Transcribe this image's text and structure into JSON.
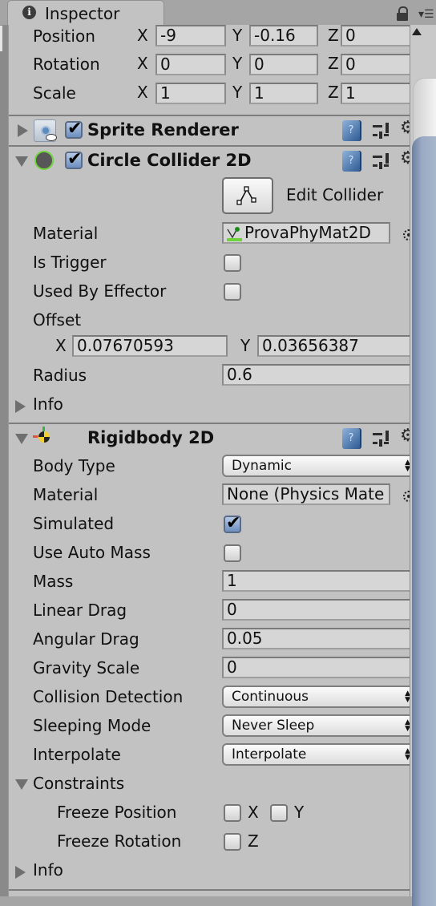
{
  "tab": {
    "title": "Inspector",
    "icon": "info-icon"
  },
  "transform": {
    "rows": [
      {
        "label": "Position",
        "x": "-9",
        "y": "-0.16",
        "z": "0"
      },
      {
        "label": "Rotation",
        "x": "0",
        "y": "0",
        "z": "0"
      },
      {
        "label": "Scale",
        "x": "1",
        "y": "1",
        "z": "1"
      }
    ],
    "axes": {
      "x": "X",
      "y": "Y",
      "z": "Z"
    }
  },
  "sprite_renderer": {
    "title": "Sprite Renderer",
    "enabled": true,
    "expanded": false
  },
  "circle_collider": {
    "title": "Circle Collider 2D",
    "enabled": true,
    "expanded": true,
    "edit_collider_label": "Edit Collider",
    "material_label": "Material",
    "material_value": "ProvaPhyMat2D",
    "is_trigger_label": "Is Trigger",
    "is_trigger": false,
    "used_by_effector_label": "Used By Effector",
    "used_by_effector": false,
    "offset_label": "Offset",
    "offset_x": "0.07670593",
    "offset_y": "0.03656387",
    "radius_label": "Radius",
    "radius": "0.6",
    "info_label": "Info"
  },
  "rigidbody": {
    "title": "Rigidbody 2D",
    "expanded": true,
    "body_type_label": "Body Type",
    "body_type": "Dynamic",
    "material_label": "Material",
    "material_value": "None (Physics Mate",
    "simulated_label": "Simulated",
    "simulated": true,
    "use_auto_mass_label": "Use Auto Mass",
    "use_auto_mass": false,
    "mass_label": "Mass",
    "mass": "1",
    "linear_drag_label": "Linear Drag",
    "linear_drag": "0",
    "angular_drag_label": "Angular Drag",
    "angular_drag": "0.05",
    "gravity_scale_label": "Gravity Scale",
    "gravity_scale": "0",
    "collision_detection_label": "Collision Detection",
    "collision_detection": "Continuous",
    "sleeping_mode_label": "Sleeping Mode",
    "sleeping_mode": "Never Sleep",
    "interpolate_label": "Interpolate",
    "interpolate": "Interpolate",
    "constraints_label": "Constraints",
    "freeze_position_label": "Freeze Position",
    "freeze_position_x": false,
    "freeze_position_y": false,
    "freeze_rotation_label": "Freeze Rotation",
    "freeze_rotation_z": false,
    "info_label": "Info"
  },
  "colors": {
    "panel_bg": "#c2c2c2",
    "collider_ring": "#6fd43b",
    "checkbox_on": "#6d8ebf",
    "scroll_thumb": "#8a9cba"
  }
}
